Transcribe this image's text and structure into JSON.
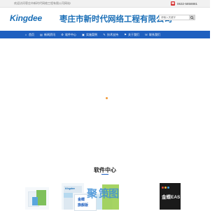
{
  "topbar": {
    "welcome": "欢迎访问枣庄市新时代网络工程有限公司网站!",
    "phone": "0632-5858881"
  },
  "header": {
    "logo": "Kingdee",
    "company_name": "枣庄市新时代网络工程有限公司",
    "search_placeholder": "请输入关键字"
  },
  "nav": {
    "items": [
      {
        "label": "首页",
        "icon": "home-icon"
      },
      {
        "label": "新闻资讯",
        "icon": "news-icon"
      },
      {
        "label": "软件中心",
        "icon": "software-icon"
      },
      {
        "label": "实施案例",
        "icon": "case-icon"
      },
      {
        "label": "技术支持",
        "icon": "support-icon"
      },
      {
        "label": "关于我们",
        "icon": "about-icon"
      },
      {
        "label": "联系我们",
        "icon": "contact-icon"
      }
    ]
  },
  "software_section": {
    "title": "软件中心",
    "products": [
      {
        "name": "Kingdee",
        "title_line1": "金蝶",
        "title_line2": "旗舰版"
      },
      {
        "title": "金蝶EAS"
      }
    ],
    "watermark_text": "聚 策图"
  },
  "colors": {
    "brand_blue": "#1b6fb7",
    "nav_blue": "#1e5fbf",
    "phone_red": "#d42a2a",
    "loader_orange": "#f29a38"
  }
}
